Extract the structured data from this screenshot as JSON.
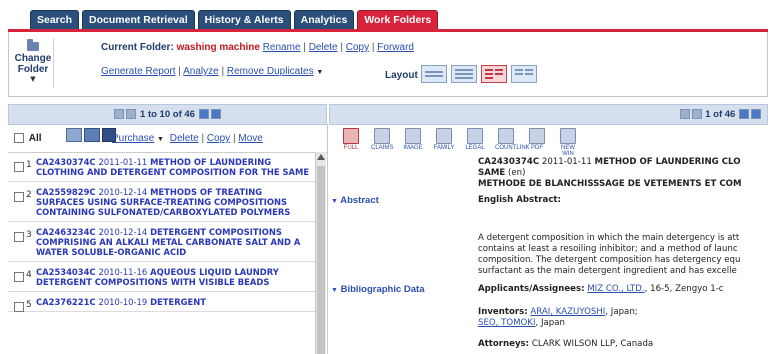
{
  "tabs": [
    "Search",
    "Document Retrieval",
    "History & Alerts",
    "Analytics",
    "Work Folders"
  ],
  "change_folder": {
    "label": "Change Folder"
  },
  "current_folder": {
    "label": "Current Folder:",
    "name": "washing machine",
    "actions": [
      "Rename",
      "Delete",
      "Copy",
      "Forward"
    ]
  },
  "report_actions": [
    "Generate Report",
    "Analyze",
    "Remove Duplicates"
  ],
  "layout_label": "Layout",
  "left_pager": {
    "text": "1 to 10 of 46"
  },
  "right_pager": {
    "text": "1 of 46"
  },
  "left_toolbar": {
    "all_label": "All",
    "actions": [
      "Purchase",
      "Delete",
      "Copy",
      "Move"
    ]
  },
  "right_toolbar": [
    "FULL",
    "CLAIMS",
    "IMAGE",
    "FAMILY",
    "LEGAL",
    "COUNTLINK",
    "PDF",
    "NEW WIN"
  ],
  "results": [
    {
      "num": "1",
      "id": "CA2430374C",
      "date": "2011-01-11",
      "title": "METHOD OF LAUNDERING CLOTHING AND DETERGENT COMPOSITION FOR THE SAME"
    },
    {
      "num": "2",
      "id": "CA2559829C",
      "date": "2010-12-14",
      "title": "METHODS OF TREATING SURFACES USING SURFACE-TREATING COMPOSITIONS CONTAINING SULFONATED/CARBOXYLATED POLYMERS"
    },
    {
      "num": "3",
      "id": "CA2463234C",
      "date": "2010-12-14",
      "title": "DETERGENT COMPOSITIONS COMPRISING AN ALKALI METAL CARBONATE SALT AND A WATER SOLUBLE-ORGANIC ACID"
    },
    {
      "num": "4",
      "id": "CA2534034C",
      "date": "2010-11-16",
      "title": "AQUEOUS LIQUID LAUNDRY DETERGENT COMPOSITIONS WITH VISIBLE BEADS"
    },
    {
      "num": "5",
      "id": "CA2376221C",
      "date": "2010-10-19",
      "title": "DETERGENT"
    }
  ],
  "detail": {
    "id": "CA2430374C",
    "date": "2011-01-11",
    "title_line1": "METHOD OF LAUNDERING CLO",
    "title_line2": "SAME",
    "lang": "(en)",
    "title_fr": "METHODE DE BLANCHISSSAGE DE VETEMENTS ET COM",
    "abstract_label": "Abstract",
    "english_abstract_label": "English Abstract:",
    "abstract_lines": [
      "A detergent composition in which the main detergency is att",
      "contains at least a resoiling inhibitor; and a method of launc",
      "composition. The detergent composition has detergency equ",
      "surfactant as the main detergent ingredient and has excelle"
    ],
    "biblio_label": "Bibliographic Data",
    "applicants_label": "Applicants/Assignees:",
    "applicant_name": "MIZ CO., LTD.",
    "applicant_addr": ", 16-5, Zengyo 1-c",
    "inventors_label": "Inventors:",
    "inventor1": "ARAI, KAZUYOSHI",
    "inventor1_loc": ", Japan;",
    "inventor2": "SEO, TOMOKI",
    "inventor2_loc": ", Japan",
    "attorneys_label": "Attorneys:",
    "attorneys": "CLARK WILSON LLP, Canada"
  }
}
